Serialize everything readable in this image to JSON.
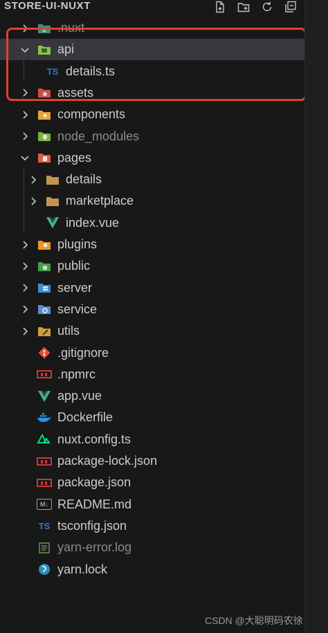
{
  "explorer": {
    "title": "STORE-UI-NUXT",
    "actions": [
      "new-file-icon",
      "new-folder-icon",
      "refresh-icon",
      "collapse-all-icon"
    ]
  },
  "tree": [
    {
      "label": ".nuxt",
      "type": "folder",
      "expanded": false,
      "depth": 0,
      "icon": "nuxt-folder-icon",
      "dim": true
    },
    {
      "label": "api",
      "type": "folder",
      "expanded": true,
      "depth": 0,
      "icon": "api-folder-icon",
      "selected": true
    },
    {
      "label": "details.ts",
      "type": "file",
      "depth": 1,
      "icon": "typescript-file-icon",
      "badge": "TS"
    },
    {
      "label": "assets",
      "type": "folder",
      "expanded": false,
      "depth": 0,
      "icon": "assets-folder-icon"
    },
    {
      "label": "components",
      "type": "folder",
      "expanded": false,
      "depth": 0,
      "icon": "components-folder-icon"
    },
    {
      "label": "node_modules",
      "type": "folder",
      "expanded": false,
      "depth": 0,
      "icon": "node-modules-folder-icon",
      "dim": true
    },
    {
      "label": "pages",
      "type": "folder",
      "expanded": true,
      "depth": 0,
      "icon": "pages-folder-icon"
    },
    {
      "label": "details",
      "type": "folder",
      "expanded": false,
      "depth": 1,
      "icon": "folder-icon"
    },
    {
      "label": "marketplace",
      "type": "folder",
      "expanded": false,
      "depth": 1,
      "icon": "folder-icon"
    },
    {
      "label": "index.vue",
      "type": "file",
      "depth": 1,
      "icon": "vue-file-icon"
    },
    {
      "label": "plugins",
      "type": "folder",
      "expanded": false,
      "depth": 0,
      "icon": "plugins-folder-icon"
    },
    {
      "label": "public",
      "type": "folder",
      "expanded": false,
      "depth": 0,
      "icon": "public-folder-icon"
    },
    {
      "label": "server",
      "type": "folder",
      "expanded": false,
      "depth": 0,
      "icon": "server-folder-icon"
    },
    {
      "label": "service",
      "type": "folder",
      "expanded": false,
      "depth": 0,
      "icon": "service-folder-icon"
    },
    {
      "label": "utils",
      "type": "folder",
      "expanded": false,
      "depth": 0,
      "icon": "utils-folder-icon"
    },
    {
      "label": ".gitignore",
      "type": "file",
      "depth": 0,
      "icon": "git-file-icon"
    },
    {
      "label": ".npmrc",
      "type": "file",
      "depth": 0,
      "icon": "npm-file-icon"
    },
    {
      "label": "app.vue",
      "type": "file",
      "depth": 0,
      "icon": "vue-file-icon"
    },
    {
      "label": "Dockerfile",
      "type": "file",
      "depth": 0,
      "icon": "docker-file-icon"
    },
    {
      "label": "nuxt.config.ts",
      "type": "file",
      "depth": 0,
      "icon": "nuxt-file-icon"
    },
    {
      "label": "package-lock.json",
      "type": "file",
      "depth": 0,
      "icon": "npm-file-icon"
    },
    {
      "label": "package.json",
      "type": "file",
      "depth": 0,
      "icon": "npm-file-icon"
    },
    {
      "label": "README.md",
      "type": "file",
      "depth": 0,
      "icon": "markdown-file-icon",
      "badge": "M↓"
    },
    {
      "label": "tsconfig.json",
      "type": "file",
      "depth": 0,
      "icon": "tsconfig-file-icon",
      "badge": "TS"
    },
    {
      "label": "yarn-error.log",
      "type": "file",
      "depth": 0,
      "icon": "log-file-icon",
      "dim": true
    },
    {
      "label": "yarn.lock",
      "type": "file",
      "depth": 0,
      "icon": "yarn-file-icon"
    }
  ],
  "watermark": "CSDN @大聪明码农徐",
  "colors": {
    "accent_red": "#e0412f",
    "vue_green": "#41b883",
    "ts_blue": "#3178c6",
    "npm_red": "#cb3837",
    "folder_tan": "#c09553"
  }
}
